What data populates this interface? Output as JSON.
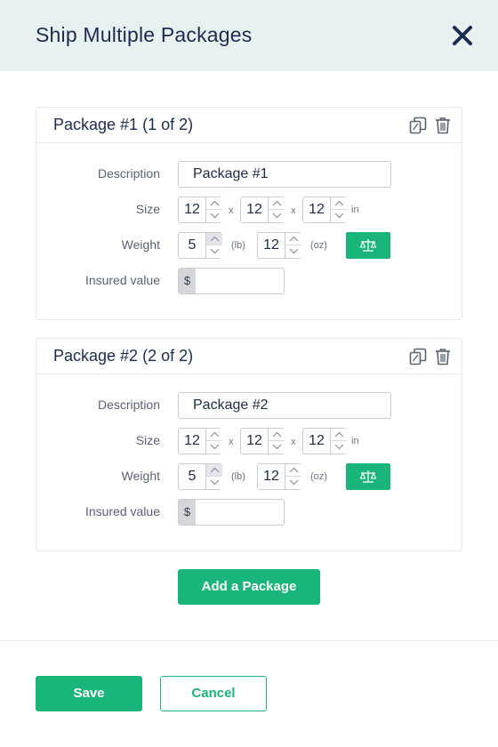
{
  "dialog": {
    "title": "Ship Multiple Packages",
    "close_icon": "close-icon"
  },
  "labels": {
    "description": "Description",
    "size": "Size",
    "weight": "Weight",
    "insured_value": "Insured  value",
    "size_sep": "x",
    "size_unit": "in",
    "weight_lb_unit": "(lb)",
    "weight_oz_unit": "(oz)",
    "currency_prefix": "$"
  },
  "packages": [
    {
      "title": "Package #1 (1 of 2)",
      "description": "Package #1",
      "size": [
        "12",
        "12",
        "12"
      ],
      "weight_lb": "5",
      "weight_oz": "12",
      "insured_value": ""
    },
    {
      "title": "Package #2 (2 of 2)",
      "description": "Package #2",
      "size": [
        "12",
        "12",
        "12"
      ],
      "weight_lb": "5",
      "weight_oz": "12",
      "insured_value": ""
    }
  ],
  "actions": {
    "add_package": "Add a Package",
    "save": "Save",
    "cancel": "Cancel"
  },
  "icons": {
    "copy": "copy-icon",
    "delete": "trash-icon",
    "scale": "scale-icon",
    "step_up": "chevron-up-icon",
    "step_down": "chevron-down-icon"
  },
  "colors": {
    "accent": "#19b57b",
    "header_bg": "#e8f0f0",
    "title_text": "#1d2b4f"
  }
}
